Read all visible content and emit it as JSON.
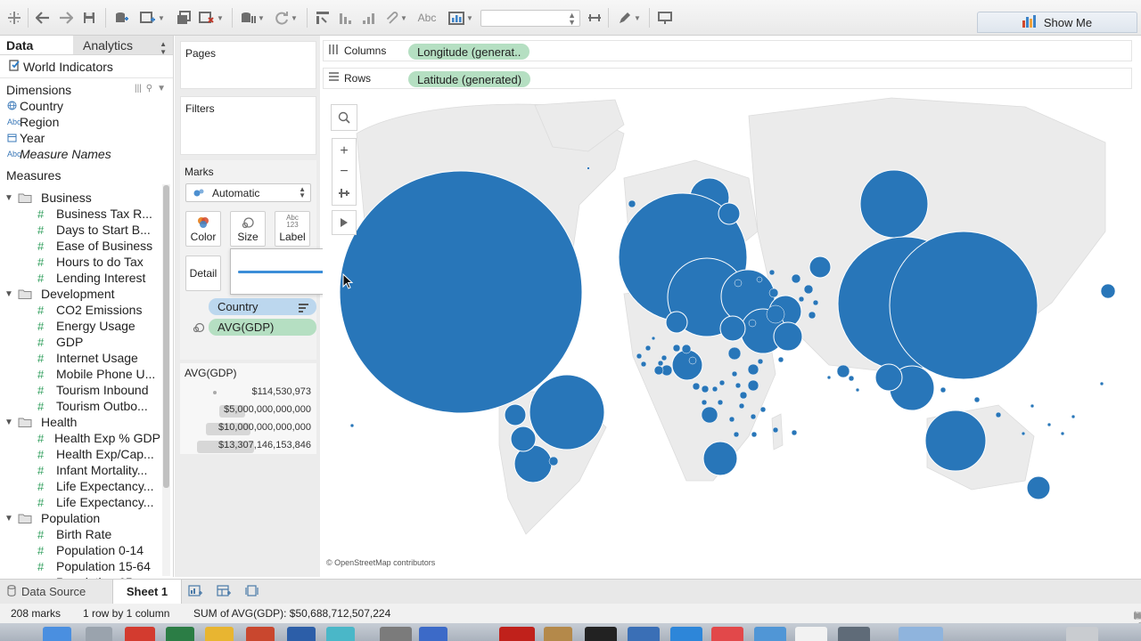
{
  "toolbar": {
    "show_me_label": "Show Me",
    "abc_label": "Abc",
    "icons": [
      "tableau-logo-icon",
      "undo-icon",
      "redo-icon",
      "save-icon",
      "new-datasource-icon",
      "new-worksheet-icon",
      "duplicate-sheet-icon",
      "clear-sheet-icon",
      "pause-updates-icon",
      "refresh-icon",
      "swap-icon",
      "sort-ascending-icon",
      "sort-descending-icon",
      "group-icon",
      "labels-icon",
      "totals-icon",
      "fit-select",
      "fix-axes-icon",
      "highlight-icon",
      "presentation-icon"
    ]
  },
  "data_pane": {
    "tab_data": "Data",
    "tab_analytics": "Analytics",
    "datasource_name": "World Indicators",
    "dimensions_header": "Dimensions",
    "dimensions": [
      {
        "type": "geo",
        "name": "Country",
        "italic": false
      },
      {
        "type": "abc",
        "name": "Region",
        "italic": false
      },
      {
        "type": "date",
        "name": "Year",
        "italic": false
      },
      {
        "type": "abc",
        "name": "Measure Names",
        "italic": true
      }
    ],
    "measures_header": "Measures",
    "folders": [
      {
        "name": "Business",
        "items": [
          "Business Tax R...",
          "Days to Start B...",
          "Ease of Business",
          "Hours to do Tax",
          "Lending Interest"
        ]
      },
      {
        "name": "Development",
        "items": [
          "CO2 Emissions",
          "Energy Usage",
          "GDP",
          "Internet Usage",
          "Mobile Phone U...",
          "Tourism Inbound",
          "Tourism Outbo..."
        ]
      },
      {
        "name": "Health",
        "items": [
          "Health Exp % GDP",
          "Health Exp/Cap...",
          "Infant Mortality...",
          "Life Expectancy...",
          "Life Expectancy..."
        ]
      },
      {
        "name": "Population",
        "items": [
          "Birth Rate",
          "Population 0-14",
          "Population 15-64",
          "Population 65+"
        ]
      }
    ],
    "abc_icon_text": "Abc"
  },
  "shelves": {
    "pages_title": "Pages",
    "filters_title": "Filters",
    "marks_title": "Marks",
    "mark_type": "Automatic",
    "color_label": "Color",
    "size_label": "Size",
    "label_label": "Label",
    "label_icon_text": "Abc\n123",
    "detail_label": "Detail",
    "pill_country": "Country",
    "pill_avg": "AVG(GDP)",
    "columns_label": "Columns",
    "columns_pill": "Longitude (generat..",
    "rows_label": "Rows",
    "rows_pill": "Latitude (generated)"
  },
  "size_slider": {
    "value": 0.69
  },
  "legend": {
    "title": "AVG(GDP)",
    "entries": [
      {
        "label": "$114,530,973",
        "fraction": 0.0
      },
      {
        "label": "$5,000,000,000,000",
        "fraction": 0.3
      },
      {
        "label": "$10,000,000,000,000",
        "fraction": 0.6
      },
      {
        "label": "$13,307,146,153,846",
        "fraction": 0.8
      }
    ]
  },
  "map": {
    "attribution": "© OpenStreetMap contributors",
    "mark_color": "#2876b9",
    "land_color": "#ebebeb"
  },
  "sheets": {
    "datasource_tab": "Data Source",
    "sheet_tab": "Sheet 1"
  },
  "status": {
    "marks": "208 marks",
    "rows_cols": "1 row by 1 column",
    "sum": "SUM of AVG(GDP): $50,688,712,507,224"
  }
}
